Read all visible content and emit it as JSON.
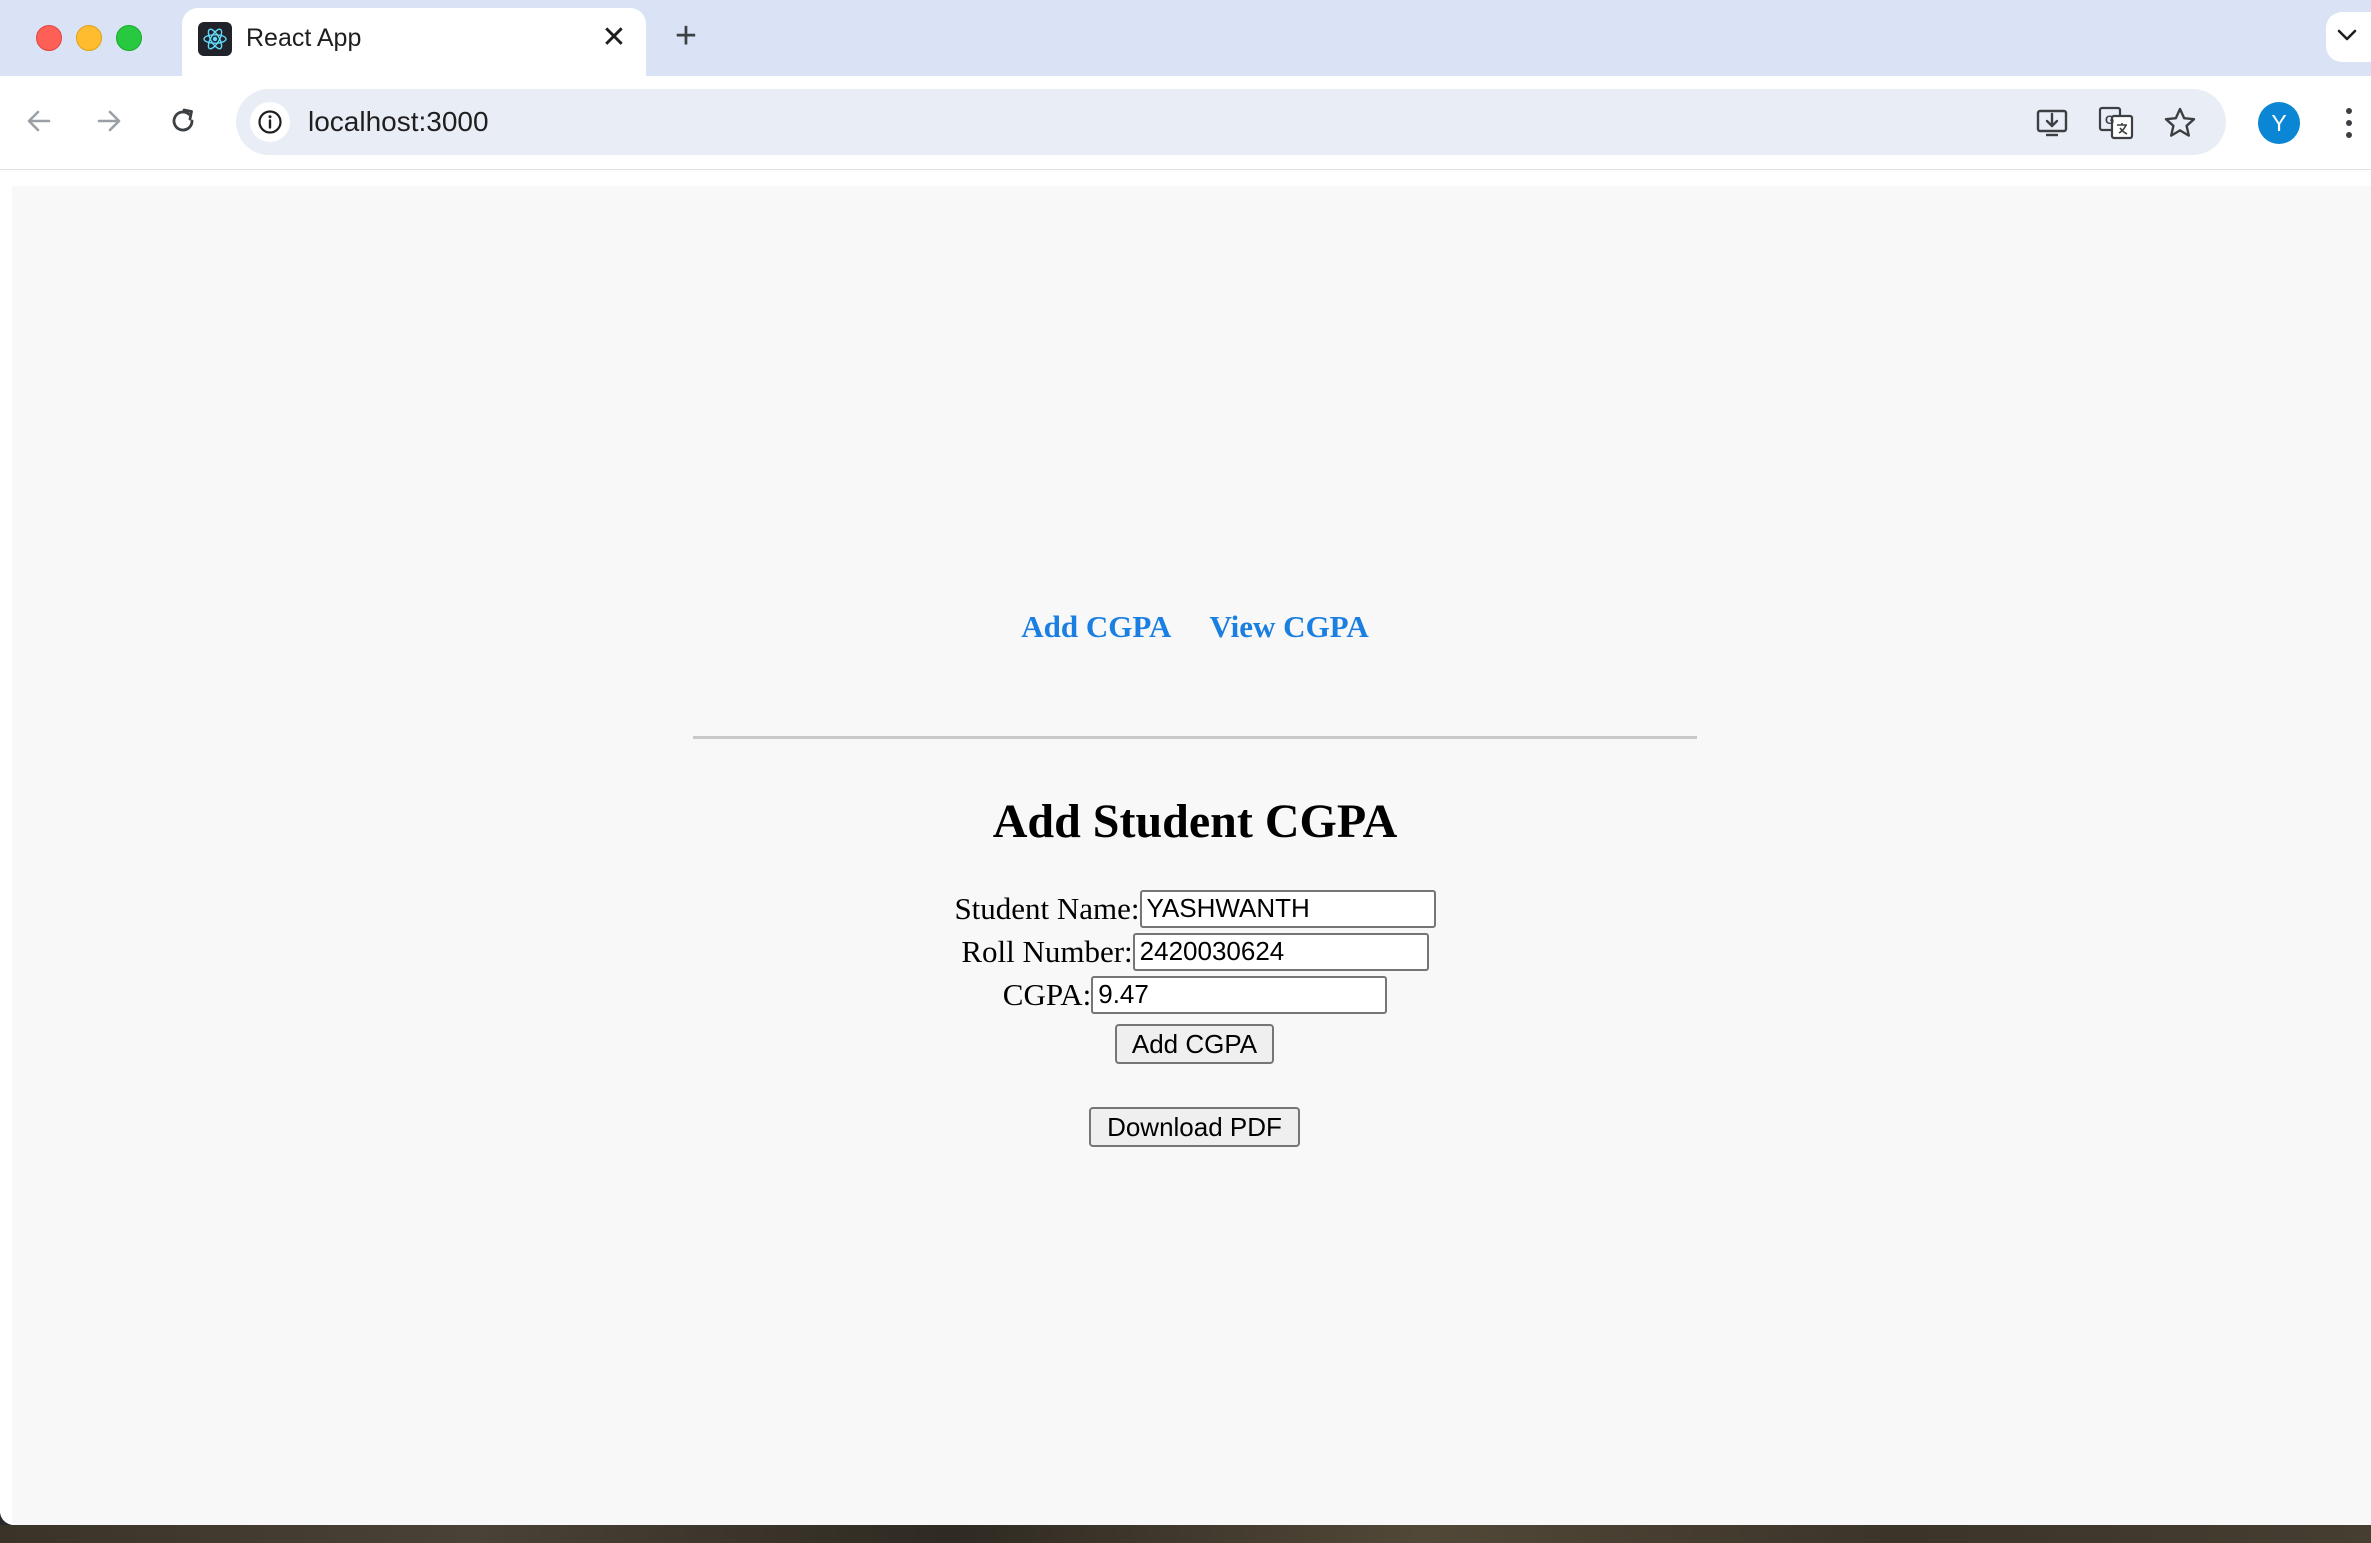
{
  "browser": {
    "tab": {
      "title": "React App",
      "favicon": "react-logo-icon",
      "close_glyph": "✕"
    },
    "new_tab_glyph": "+",
    "address_bar": {
      "url": "localhost:3000"
    },
    "profile_initial": "Y",
    "colors": {
      "tabstrip": "#d9e3f5",
      "omnibox": "#e9eef6",
      "avatar": "#0b86d4"
    }
  },
  "app": {
    "nav": {
      "add_label": "Add CGPA",
      "view_label": "View CGPA"
    },
    "form": {
      "title": "Add Student CGPA",
      "name_label": "Student Name:",
      "name_value": "YASHWANTH",
      "roll_label": "Roll Number:",
      "roll_value": "2420030624",
      "cgpa_label": "CGPA:",
      "cgpa_value": "9.47",
      "submit_label": "Add CGPA"
    },
    "download_label": "Download PDF",
    "colors": {
      "link": "#1a7fe0",
      "background": "#f8f8f8"
    }
  }
}
